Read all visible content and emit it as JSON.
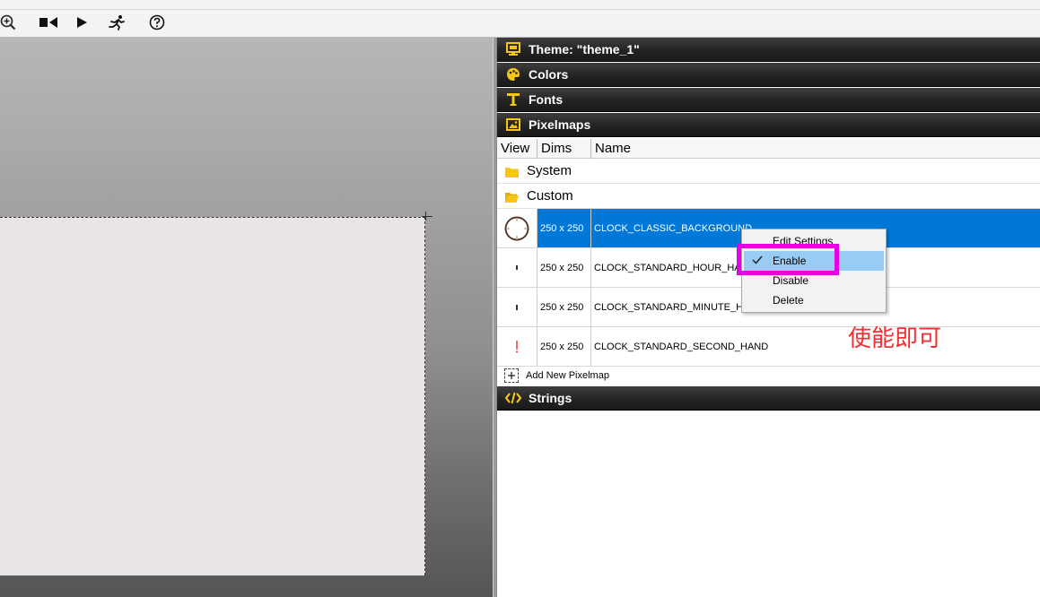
{
  "toolbar": {
    "icons": [
      "zoom-in-icon",
      "record-stop-icon",
      "play-icon",
      "run-icon",
      "help-icon"
    ]
  },
  "panel": {
    "sections": {
      "theme": "Theme: \"theme_1\"",
      "colors": "Colors",
      "fonts": "Fonts",
      "pixelmaps": "Pixelmaps",
      "strings": "Strings"
    },
    "columns": {
      "view": "View",
      "dims": "Dims",
      "name": "Name"
    },
    "folders": {
      "system": "System",
      "custom": "Custom"
    },
    "pixelmaps": [
      {
        "dims": "250 x 250",
        "name": "CLOCK_CLASSIC_BACKGROUND",
        "selected": true
      },
      {
        "dims": "250 x 250",
        "name": "CLOCK_STANDARD_HOUR_HAND"
      },
      {
        "dims": "250 x 250",
        "name": "CLOCK_STANDARD_MINUTE_HAND"
      },
      {
        "dims": "250 x 250",
        "name": "CLOCK_STANDARD_SECOND_HAND"
      }
    ],
    "add_new": "Add New Pixelmap"
  },
  "context_menu": {
    "items": [
      "Edit Settings",
      "Enable",
      "Disable",
      "Delete"
    ],
    "highlighted": "Enable"
  },
  "annotation": "使能即可",
  "colors": {
    "selection": "#0078d7",
    "menu_highlight": "#99ccf5",
    "callout_box": "#e500e5",
    "annotation_text": "#f03030",
    "section_icon": "#f5c518"
  }
}
